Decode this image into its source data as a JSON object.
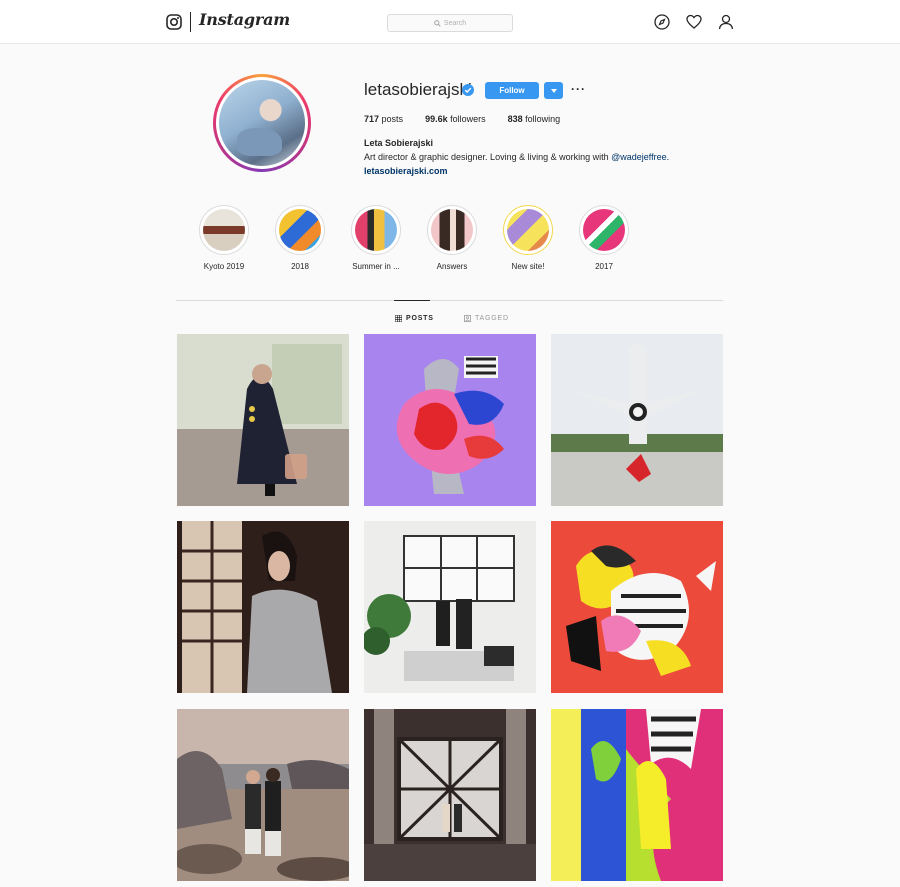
{
  "nav": {
    "brand": "Instagram",
    "search_placeholder": "Search",
    "icons": [
      "instagram-glyph-icon",
      "explore-compass-icon",
      "activity-heart-icon",
      "profile-person-icon"
    ]
  },
  "profile": {
    "username": "letasobierajski",
    "verified": true,
    "follow_label": "Follow",
    "dropdown_label": "▾",
    "more_label": "···",
    "stats": {
      "posts_value": "717",
      "posts_label": "posts",
      "followers_value": "99.6k",
      "followers_label": "followers",
      "following_value": "838",
      "following_label": "following"
    },
    "full_name": "Leta Sobierajski",
    "bio_text": "Art director & graphic designer. Loving & living & working with ",
    "bio_mention": "@wadejeffree.",
    "website": "letasobierajski.com"
  },
  "highlights": [
    {
      "label": "Kyoto 2019"
    },
    {
      "label": "2018"
    },
    {
      "label": "Summer in ..."
    },
    {
      "label": "Answers"
    },
    {
      "label": "New site!"
    },
    {
      "label": "2017"
    }
  ],
  "tabs": {
    "posts": "POSTS",
    "tagged": "TAGGED",
    "active": "posts"
  },
  "colors": {
    "accent_blue": "#3897f0",
    "link_navy": "#003569",
    "text": "#262626",
    "background": "#fafafa"
  },
  "posts_count_visible": 9
}
